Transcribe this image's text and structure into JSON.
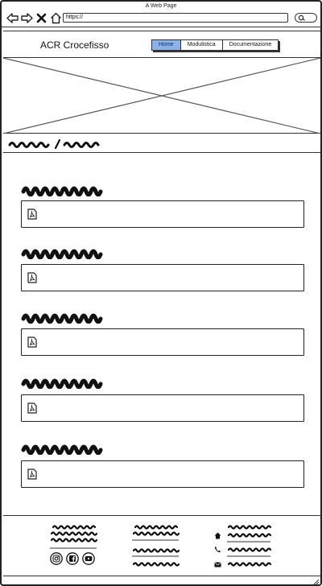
{
  "browser": {
    "title": "A Web Page",
    "url": "https://"
  },
  "header": {
    "brand": "ACR Crocefisso",
    "menu": [
      {
        "label": "Home",
        "active": true
      },
      {
        "label": "Modulistica",
        "active": false
      },
      {
        "label": "Documentazione",
        "active": false
      }
    ]
  },
  "colors": {
    "active_menu_bg": "#8bb1e8",
    "ink": "#111111"
  },
  "icons": {
    "document": "pdf-icon",
    "social": [
      "instagram-icon",
      "facebook-icon",
      "youtube-icon"
    ],
    "contact": [
      "home-icon",
      "phone-icon",
      "envelope-icon"
    ]
  }
}
